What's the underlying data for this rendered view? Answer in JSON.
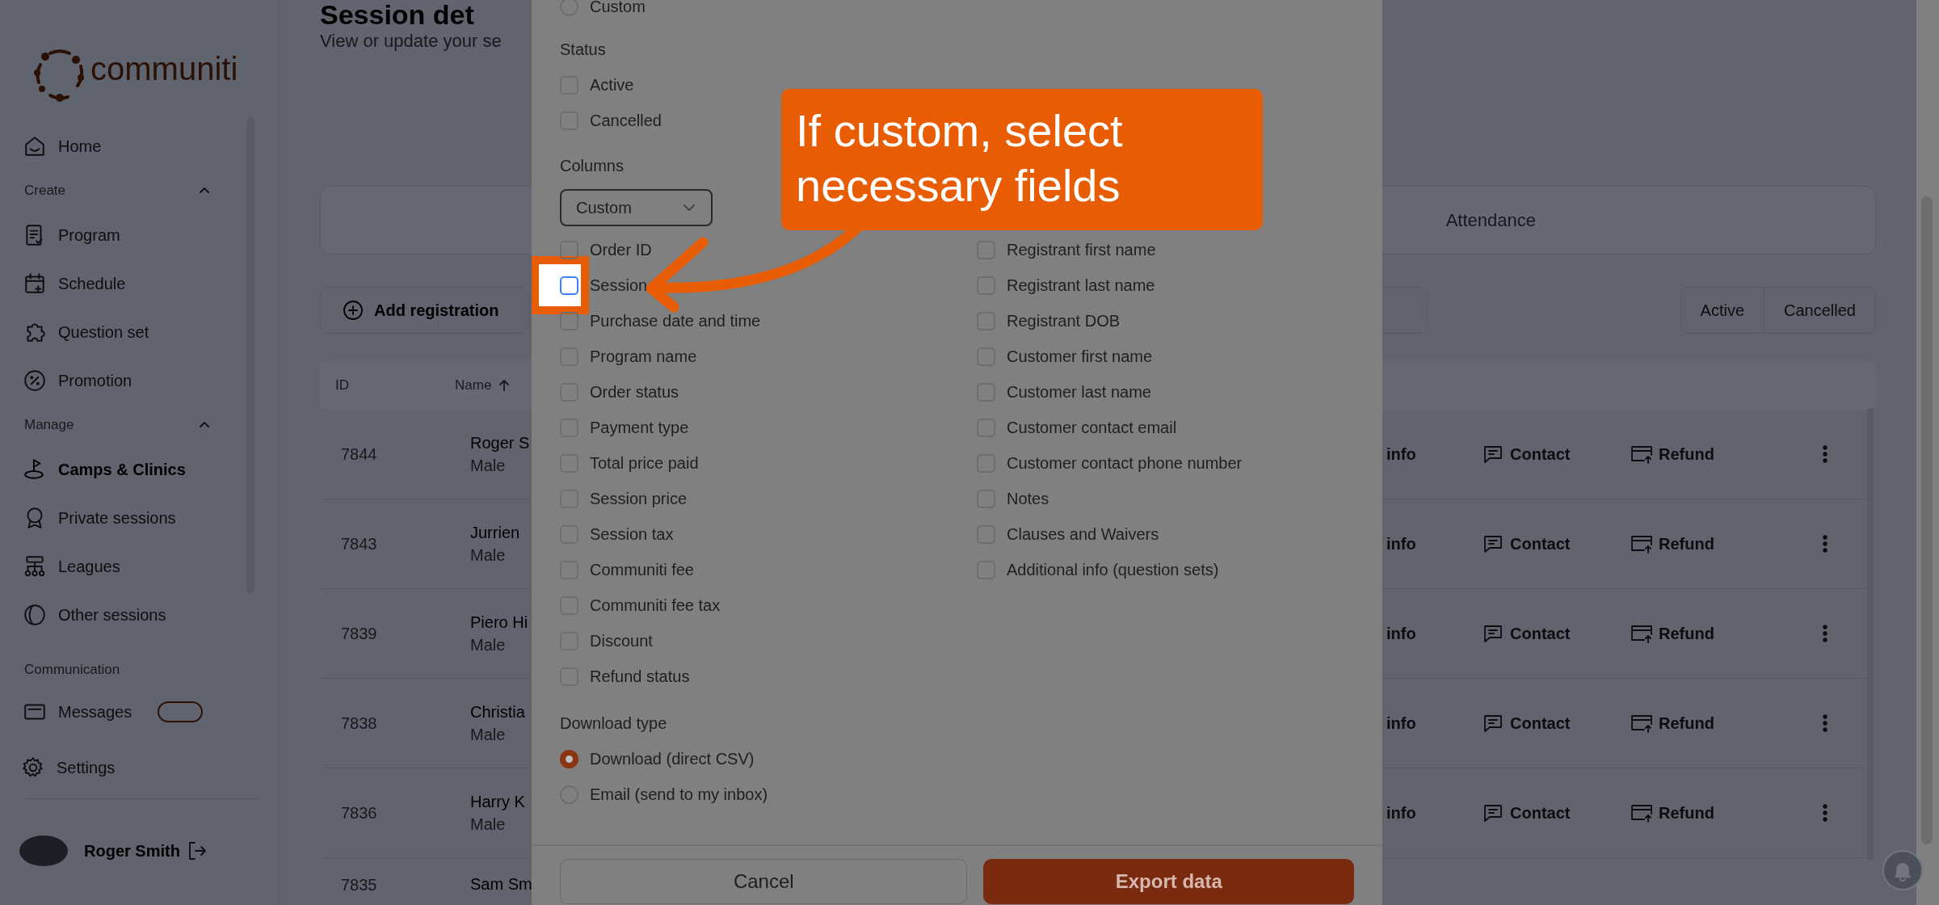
{
  "sidebar": {
    "logo_text": "communiti",
    "items": [
      {
        "kind": "link",
        "label": "Home",
        "selected": false
      },
      {
        "kind": "section",
        "label": "Create",
        "expanded": true
      },
      {
        "kind": "link",
        "label": "Program",
        "selected": false
      },
      {
        "kind": "link",
        "label": "Schedule",
        "selected": false
      },
      {
        "kind": "link",
        "label": "Question set",
        "selected": false
      },
      {
        "kind": "link",
        "label": "Promotion",
        "selected": false
      },
      {
        "kind": "section",
        "label": "Manage",
        "expanded": true
      },
      {
        "kind": "link",
        "label": "Camps & Clinics",
        "selected": true
      },
      {
        "kind": "link",
        "label": "Private sessions",
        "selected": false
      },
      {
        "kind": "link",
        "label": "Leagues",
        "selected": false
      },
      {
        "kind": "link",
        "label": "Other sessions",
        "selected": false
      },
      {
        "kind": "section",
        "label": "Communication"
      },
      {
        "kind": "link",
        "label": "Messages",
        "selected": false,
        "badge": true
      }
    ],
    "settings": "Settings",
    "user": "Roger Smith"
  },
  "page": {
    "title": "Session det",
    "subtitle": "View or update your se",
    "tabs": [
      {
        "label": "Attendance",
        "selected": false
      }
    ],
    "add_button": "Add registration",
    "filters": [
      {
        "label": "Active",
        "selected": false
      },
      {
        "label": "Cancelled",
        "selected": false
      }
    ],
    "table": {
      "columns": [
        "ID",
        "Name"
      ],
      "rows": [
        {
          "id": "7844",
          "name": "Roger S",
          "detail": "Male",
          "actions": [
            "info",
            "Contact",
            "Refund"
          ]
        },
        {
          "id": "7843",
          "name": "Jurrien",
          "detail": "Male",
          "actions": [
            "info",
            "Contact",
            "Refund"
          ]
        },
        {
          "id": "7839",
          "name": "Piero Hi",
          "detail": "Male",
          "actions": [
            "info",
            "Contact",
            "Refund"
          ]
        },
        {
          "id": "7838",
          "name": "Christia",
          "detail": "Male",
          "actions": [
            "info",
            "Contact",
            "Refund"
          ]
        },
        {
          "id": "7836",
          "name": "Harry K",
          "detail": "Male",
          "actions": [
            "info",
            "Contact",
            "Refund"
          ]
        },
        {
          "id": "7835",
          "name": "Sam Sm"
        }
      ]
    }
  },
  "modal": {
    "top_option": {
      "label": "Custom",
      "selected": false
    },
    "status": {
      "title": "Status",
      "options": [
        {
          "label": "Active",
          "checked": false
        },
        {
          "label": "Cancelled",
          "checked": false
        }
      ]
    },
    "columns": {
      "title": "Columns",
      "select": "Custom",
      "left": [
        {
          "label": "Order ID",
          "checked": false
        },
        {
          "label": "Session",
          "checked": false,
          "highlighted": true
        },
        {
          "label": "Purchase date and time",
          "checked": false
        },
        {
          "label": "Program name",
          "checked": false
        },
        {
          "label": "Order status",
          "checked": false
        },
        {
          "label": "Payment type",
          "checked": false
        },
        {
          "label": "Total price paid",
          "checked": false
        },
        {
          "label": "Session price",
          "checked": false
        },
        {
          "label": "Session tax",
          "checked": false
        },
        {
          "label": "Communiti fee",
          "checked": false
        },
        {
          "label": "Communiti fee tax",
          "checked": false
        },
        {
          "label": "Discount",
          "checked": false
        },
        {
          "label": "Refund status",
          "checked": false
        }
      ],
      "right": [
        {
          "label": "Registrant first name",
          "checked": false
        },
        {
          "label": "Registrant last name",
          "checked": false
        },
        {
          "label": "Registrant DOB",
          "checked": false
        },
        {
          "label": "Customer first name",
          "checked": false
        },
        {
          "label": "Customer last name",
          "checked": false
        },
        {
          "label": "Customer contact email",
          "checked": false
        },
        {
          "label": "Customer contact phone number",
          "checked": false
        },
        {
          "label": "Notes",
          "checked": false
        },
        {
          "label": "Clauses and Waivers",
          "checked": false
        },
        {
          "label": "Additional info (question sets)",
          "checked": false
        }
      ]
    },
    "download_type": {
      "title": "Download type",
      "options": [
        {
          "label": "Download (direct CSV)",
          "selected": true
        },
        {
          "label": "Email (send to my inbox)",
          "selected": false
        }
      ]
    },
    "cancel": "Cancel",
    "export": "Export data"
  },
  "callout": {
    "lines": [
      "If custom, select",
      "necessary fields"
    ]
  }
}
